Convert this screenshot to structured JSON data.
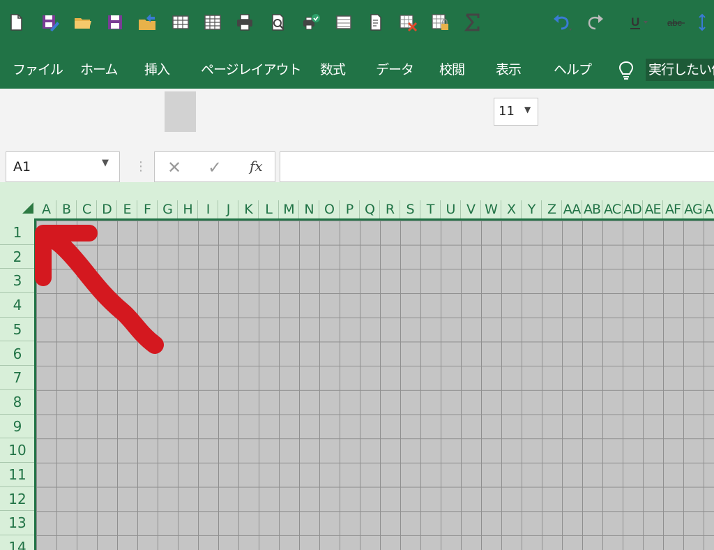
{
  "menu": {
    "items": [
      {
        "label": "ファイル",
        "name": "menu-file"
      },
      {
        "label": "ホーム",
        "name": "menu-home"
      },
      {
        "label": "挿入",
        "name": "menu-insert"
      },
      {
        "label": "ページレイアウト",
        "name": "menu-page-layout"
      },
      {
        "label": "数式",
        "name": "menu-formulas"
      },
      {
        "label": "データ",
        "name": "menu-data"
      },
      {
        "label": "校閲",
        "name": "menu-review"
      },
      {
        "label": "表示",
        "name": "menu-view"
      },
      {
        "label": "ヘルプ",
        "name": "menu-help"
      }
    ],
    "tell_me": "実行したい作"
  },
  "toolbar": {
    "font_size": "11",
    "icons": [
      "new-file-icon",
      "save-as-icon",
      "open-folder-icon",
      "save-icon",
      "recent-folder-icon",
      "grid-icon",
      "grid-alt-icon",
      "print-icon",
      "print-preview-icon",
      "printer-check-icon",
      "form-icon",
      "document-icon",
      "delete-sheet-icon",
      "protect-sheet-icon",
      "sum-icon",
      "undo-icon",
      "redo-icon",
      "underline-icon",
      "strikethrough-icon",
      "sort-icon"
    ]
  },
  "formula_bar": {
    "name_box": "A1",
    "fx_label": "fx",
    "cancel_label": "✕",
    "enter_label": "✓",
    "formula": ""
  },
  "sheet": {
    "columns": [
      "A",
      "B",
      "C",
      "D",
      "E",
      "F",
      "G",
      "H",
      "I",
      "J",
      "K",
      "L",
      "M",
      "N",
      "O",
      "P",
      "Q",
      "R",
      "S",
      "T",
      "U",
      "V",
      "W",
      "X",
      "Y",
      "Z",
      "AA",
      "AB",
      "AC",
      "AD",
      "AE",
      "AF",
      "AG",
      "AH"
    ],
    "rows": [
      "1",
      "2",
      "3",
      "4",
      "5",
      "6",
      "7",
      "8",
      "9",
      "10",
      "11",
      "12",
      "13",
      "14"
    ]
  },
  "colors": {
    "ribbon": "#217346",
    "header_bg": "#d8efd9",
    "header_text": "#217346",
    "grid_bg": "#c5c5c5",
    "annotation_arrow": "#d4181f"
  }
}
